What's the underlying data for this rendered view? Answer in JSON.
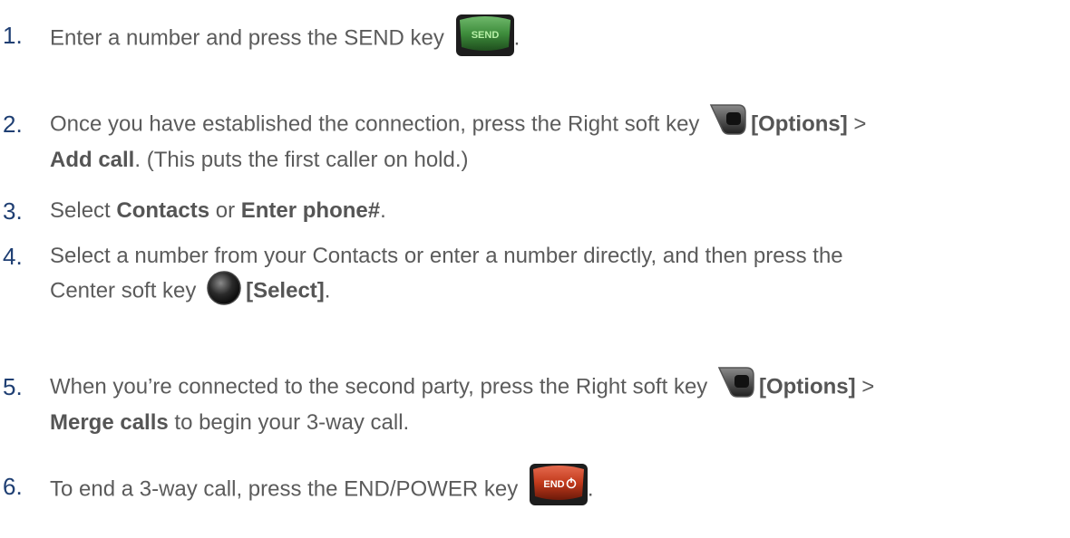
{
  "steps": [
    {
      "number": "1.",
      "text_1": "Enter a number and press the SEND key",
      "key_icon": "send-key-icon",
      "key_label": "SEND",
      "text_2": "."
    },
    {
      "number": "2.",
      "text_1": "Once you have established the connection, press the Right soft key",
      "key_icon": "right-soft-key-icon",
      "bold_1": "[Options]",
      "text_2": " > ",
      "bold_2": "Add call",
      "text_3": ". (This puts the first caller on hold.)"
    },
    {
      "number": "3.",
      "text_1": "Select ",
      "bold_1": "Contacts",
      "text_2": " or ",
      "bold_2": "Enter phone#",
      "text_3": "."
    },
    {
      "number": "4.",
      "text_1": "Select a number from your Contacts or enter a number directly, and then press the",
      "text_2": "Center soft key",
      "key_icon": "center-soft-key-icon",
      "bold_1": "[Select]",
      "text_3": "."
    },
    {
      "number": "5.",
      "text_1": "When you’re connected to the second party, press the Right soft key",
      "key_icon": "right-soft-key-icon",
      "bold_1": "[Options]",
      "text_2": " >",
      "bold_2": "Merge calls",
      "text_3": " to begin your 3-way call."
    },
    {
      "number": "6.",
      "text_1": "To end a 3-way call, press the END/POWER key",
      "key_icon": "end-power-key-icon",
      "key_label": "END",
      "text_2": "."
    }
  ],
  "colors": {
    "number": "#1f3f73",
    "text": "#5b5b5b",
    "send_key": "#3a8a3a",
    "end_key": "#c83a1e"
  }
}
